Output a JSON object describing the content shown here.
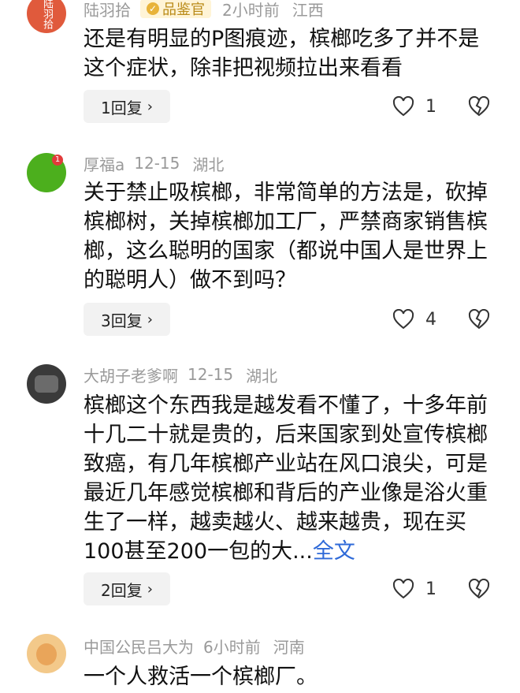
{
  "comments": [
    {
      "user": "陆羽拾",
      "badge": "品鉴官",
      "time": "2小时前",
      "location": "江西",
      "text": "还是有明显的P图痕迹，槟榔吃多了并不是这个症状，除非把视频拉出来看看",
      "more": "",
      "replies": "1回复",
      "likes": "1",
      "avatar_text": "陆羽拾"
    },
    {
      "user": "厚福a",
      "badge": "",
      "time": "12-15",
      "location": "湖北",
      "text": "关于禁止吸槟榔，非常简单的方法是，砍掉槟榔树，关掉槟榔加工厂，严禁商家销售槟榔，这么聪明的国家（都说中国人是世界上的聪明人）做不到吗？",
      "more": "",
      "replies": "3回复",
      "likes": "4",
      "avatar_badge": "1"
    },
    {
      "user": "大胡子老爹啊",
      "badge": "",
      "time": "12-15",
      "location": "湖北",
      "text": "槟榔这个东西我是越发看不懂了，十多年前十几二十就是贵的，后来国家到处宣传槟榔致癌，有几年槟榔产业站在风口浪尖，可是最近几年感觉槟榔和背后的产业像是浴火重生了一样，越卖越火、越来越贵，现在买100甚至200一包的大...",
      "more": "全文",
      "replies": "2回复",
      "likes": "1"
    },
    {
      "user": "中国公民吕大为",
      "badge": "",
      "time": "6小时前",
      "location": "河南",
      "text": "一个人救活一个槟榔厂。",
      "more": ""
    }
  ],
  "icons": {
    "like": "heart-outline-icon",
    "dislike": "broken-heart-icon",
    "chevron": "chevron-right-icon"
  },
  "colors": {
    "link": "#2f6ad8",
    "meta": "#9a9a9a",
    "badge_bg": "#fff4d6",
    "badge_text": "#b98a17"
  }
}
